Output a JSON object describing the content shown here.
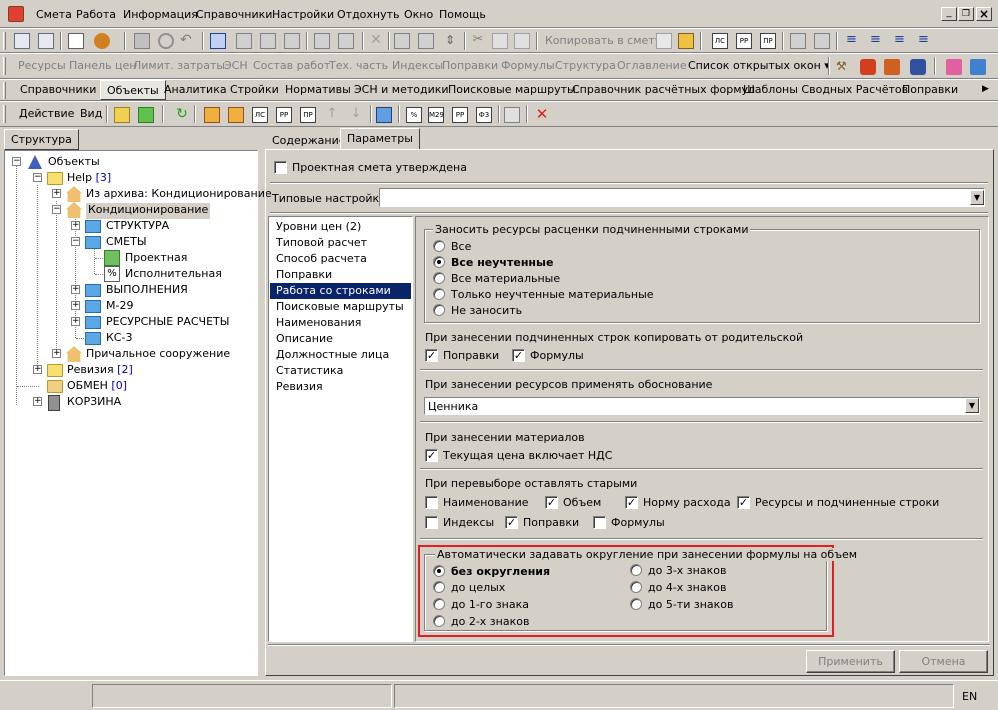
{
  "menu": {
    "items": [
      "Смета",
      "Работа",
      "Информация",
      "Справочники",
      "Настройки",
      "Отдохнуть",
      "Окно",
      "Помощь"
    ]
  },
  "window_controls": {
    "minimize": "_",
    "restore": "❐",
    "close": "×"
  },
  "toolbar1": {
    "copy_to_estimate": "Копировать в смету"
  },
  "toolbar2": {
    "items": [
      "Ресурсы",
      "Панель цен",
      "Лимит. затраты",
      "ЭСН",
      "Состав работ",
      "Тех. часть",
      "Индексы",
      "Поправки",
      "Формулы",
      "Структура",
      "Оглавление"
    ],
    "open_windows": "Список открытых окон ▾"
  },
  "tabs_main": [
    "Справочники",
    "Объекты",
    "Аналитика",
    "Стройки",
    "Нормативы",
    "ЭСН и методики",
    "Поисковые маршруты",
    "Справочник расчётных формул",
    "Шаблоны Сводных Расчётов",
    "Поправки"
  ],
  "toolbar3": {
    "action": "Действие",
    "view": "Вид"
  },
  "left_tab": "Структура",
  "tree": [
    {
      "label": "Объекты",
      "count": ""
    },
    {
      "label": "Help",
      "count": "[3]"
    },
    {
      "label": "Из архива: Кондиционирование",
      "count": ""
    },
    {
      "label": "Кондиционирование",
      "count": ""
    },
    {
      "label": "СТРУКТУРА",
      "count": ""
    },
    {
      "label": "СМЕТЫ",
      "count": ""
    },
    {
      "label": "Проектная",
      "count": ""
    },
    {
      "label": "Исполнительная",
      "count": ""
    },
    {
      "label": "ВЫПОЛНЕНИЯ",
      "count": ""
    },
    {
      "label": "М-29",
      "count": ""
    },
    {
      "label": "РЕСУРСНЫЕ РАСЧЕТЫ",
      "count": ""
    },
    {
      "label": "КС-3",
      "count": ""
    },
    {
      "label": "Причальное сооружение",
      "count": ""
    },
    {
      "label": "Ревизия",
      "count": "[2]"
    },
    {
      "label": "ОБМЕН",
      "count": "[0]"
    },
    {
      "label": "КОРЗИНА",
      "count": ""
    }
  ],
  "right_tabs": [
    "Содержание",
    "Параметры"
  ],
  "approved_label": "Проектная смета утверждена",
  "typical_label": "Типовые настройки:",
  "typical_value": "",
  "settings_list": [
    "Уровни цен (2)",
    "Типовой расчет",
    "Способ расчета",
    "Поправки",
    "Работа со строками",
    "Поисковые маршруты",
    "Наименования",
    "Описание",
    "Должностные лица",
    "Статистика",
    "Ревизия"
  ],
  "selected_setting": "Работа со строками",
  "grp_resources": {
    "title": "Заносить ресурсы расценки подчиненными строками",
    "options": [
      "Все",
      "Все неучтенные",
      "Все материальные",
      "Только неучтенные материальные",
      "Не заносить"
    ],
    "selected": 1
  },
  "copy_from_parent": {
    "title": "При занесении подчиненных строк копировать от родительской",
    "items": [
      {
        "label": "Поправки",
        "checked": true
      },
      {
        "label": "Формулы",
        "checked": true
      }
    ]
  },
  "justification": {
    "title": "При занесении ресурсов применять обоснование",
    "value": "Ценника"
  },
  "materials": {
    "title": "При занесении материалов",
    "item": {
      "label": "Текущая цена включает НДС",
      "checked": true
    }
  },
  "keep_old": {
    "title": "При перевыборе оставлять старыми",
    "items": [
      {
        "label": "Наименование",
        "checked": false
      },
      {
        "label": "Объем",
        "checked": true
      },
      {
        "label": "Норму расхода",
        "checked": true
      },
      {
        "label": "Ресурсы и подчиненные строки",
        "checked": true
      },
      {
        "label": "Индексы",
        "checked": false
      },
      {
        "label": "Поправки",
        "checked": true
      },
      {
        "label": "Формулы",
        "checked": false
      }
    ]
  },
  "rounding": {
    "title": "Автоматически задавать округление при занесении формулы на объем",
    "options": [
      "без округления",
      "до целых",
      "до 1-го знака",
      "до 2-х знаков",
      "до 3-х знаков",
      "до 4-х знаков",
      "до 5-ти знаков"
    ],
    "selected": 0
  },
  "buttons": {
    "apply": "Применить",
    "cancel": "Отмена"
  },
  "status": {
    "lang": "EN"
  },
  "colors": {
    "highlight": "#0a246a",
    "red_box": "#e02020"
  }
}
